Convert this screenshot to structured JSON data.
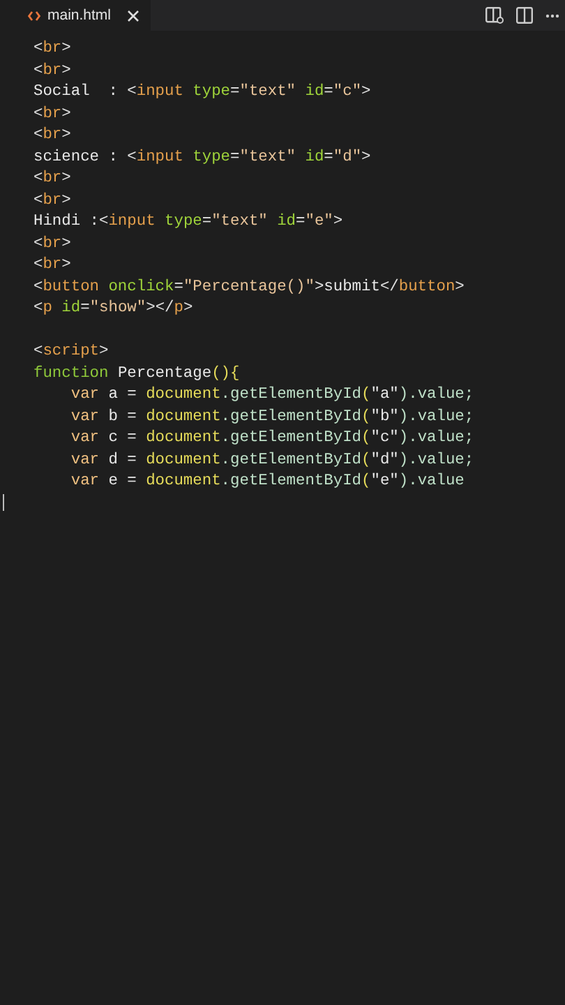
{
  "tabs": [
    {
      "label": "main.html",
      "selected": true
    }
  ],
  "lines": [
    {
      "kind": "code",
      "tokens": [
        {
          "text": "<",
          "kind": "punct"
        },
        {
          "text": "br",
          "kind": "tag"
        },
        {
          "text": ">",
          "kind": "punct"
        }
      ]
    },
    {
      "kind": "code",
      "tokens": [
        {
          "text": "<",
          "kind": "punct"
        },
        {
          "text": "br",
          "kind": "tag"
        },
        {
          "text": ">",
          "kind": "punct"
        }
      ]
    },
    {
      "kind": "code",
      "tokens": [
        {
          "text": "Social  : ",
          "kind": "plain"
        },
        {
          "text": "<",
          "kind": "punct"
        },
        {
          "text": "input ",
          "kind": "tag"
        },
        {
          "text": "type",
          "kind": "attr"
        },
        {
          "text": "=",
          "kind": "plain"
        },
        {
          "text": "\"text\" ",
          "kind": "str"
        },
        {
          "text": "id",
          "kind": "attr"
        },
        {
          "text": "=",
          "kind": "plain"
        },
        {
          "text": "\"c\"",
          "kind": "str"
        },
        {
          "text": ">",
          "kind": "punct"
        }
      ]
    },
    {
      "kind": "code",
      "tokens": [
        {
          "text": "<",
          "kind": "punct"
        },
        {
          "text": "br",
          "kind": "tag"
        },
        {
          "text": ">",
          "kind": "punct"
        }
      ]
    },
    {
      "kind": "code",
      "tokens": [
        {
          "text": "<",
          "kind": "punct"
        },
        {
          "text": "br",
          "kind": "tag"
        },
        {
          "text": ">",
          "kind": "punct"
        }
      ]
    },
    {
      "kind": "code",
      "tokens": [
        {
          "text": "science : ",
          "kind": "plain"
        },
        {
          "text": "<",
          "kind": "punct"
        },
        {
          "text": "input ",
          "kind": "tag"
        },
        {
          "text": "type",
          "kind": "attr"
        },
        {
          "text": "=",
          "kind": "plain"
        },
        {
          "text": "\"text\" ",
          "kind": "str"
        },
        {
          "text": "id",
          "kind": "attr"
        },
        {
          "text": "=",
          "kind": "plain"
        },
        {
          "text": "\"d\"",
          "kind": "str"
        },
        {
          "text": ">",
          "kind": "punct"
        }
      ]
    },
    {
      "kind": "code",
      "tokens": [
        {
          "text": "<",
          "kind": "punct"
        },
        {
          "text": "br",
          "kind": "tag"
        },
        {
          "text": ">",
          "kind": "punct"
        }
      ]
    },
    {
      "kind": "code",
      "tokens": [
        {
          "text": "<",
          "kind": "punct"
        },
        {
          "text": "br",
          "kind": "tag"
        },
        {
          "text": ">",
          "kind": "punct"
        }
      ]
    },
    {
      "kind": "code",
      "tokens": [
        {
          "text": "Hindi :",
          "kind": "plain"
        },
        {
          "text": "<",
          "kind": "punct"
        },
        {
          "text": "input ",
          "kind": "tag"
        },
        {
          "text": "type",
          "kind": "attr"
        },
        {
          "text": "=",
          "kind": "plain"
        },
        {
          "text": "\"text\" ",
          "kind": "str"
        },
        {
          "text": "id",
          "kind": "attr"
        },
        {
          "text": "=",
          "kind": "plain"
        },
        {
          "text": "\"e\"",
          "kind": "str"
        },
        {
          "text": ">",
          "kind": "punct"
        }
      ]
    },
    {
      "kind": "code",
      "tokens": [
        {
          "text": "<",
          "kind": "punct"
        },
        {
          "text": "br",
          "kind": "tag"
        },
        {
          "text": ">",
          "kind": "punct"
        }
      ]
    },
    {
      "kind": "code",
      "tokens": [
        {
          "text": "<",
          "kind": "punct"
        },
        {
          "text": "br",
          "kind": "tag"
        },
        {
          "text": ">",
          "kind": "punct"
        }
      ]
    },
    {
      "kind": "code",
      "tokens": [
        {
          "text": "<",
          "kind": "punct"
        },
        {
          "text": "button ",
          "kind": "tag"
        },
        {
          "text": "onclick",
          "kind": "attr"
        },
        {
          "text": "=",
          "kind": "plain"
        },
        {
          "text": "\"Percentage()\"",
          "kind": "str"
        },
        {
          "text": ">submit",
          "kind": "plain"
        },
        {
          "text": "</",
          "kind": "punct"
        },
        {
          "text": "button",
          "kind": "tag"
        },
        {
          "text": ">",
          "kind": "punct"
        }
      ]
    },
    {
      "kind": "code",
      "tokens": [
        {
          "text": "<",
          "kind": "punct"
        },
        {
          "text": "p ",
          "kind": "tag"
        },
        {
          "text": "id",
          "kind": "attr"
        },
        {
          "text": "=",
          "kind": "plain"
        },
        {
          "text": "\"show\"",
          "kind": "str"
        },
        {
          "text": "></",
          "kind": "punct"
        },
        {
          "text": "p",
          "kind": "tag"
        },
        {
          "text": ">",
          "kind": "punct"
        }
      ]
    },
    {
      "kind": "blank"
    },
    {
      "kind": "code",
      "tokens": [
        {
          "text": "<",
          "kind": "punct"
        },
        {
          "text": "script",
          "kind": "tag"
        },
        {
          "text": ">",
          "kind": "punct"
        }
      ]
    },
    {
      "kind": "code",
      "tokens": [
        {
          "text": "function ",
          "kind": "kw"
        },
        {
          "text": "Percentage",
          "kind": "plain"
        },
        {
          "text": "(){",
          "kind": "obj"
        }
      ]
    },
    {
      "kind": "code",
      "tokens": [
        {
          "text": "    var ",
          "kind": "var"
        },
        {
          "text": "a = ",
          "kind": "plain"
        },
        {
          "text": "document",
          "kind": "obj"
        },
        {
          "text": ".getElementById",
          "kind": "method"
        },
        {
          "text": "(",
          "kind": "obj"
        },
        {
          "text": "\"a\"",
          "kind": "plain"
        },
        {
          "text": ").value;",
          "kind": "method"
        }
      ]
    },
    {
      "kind": "code",
      "tokens": [
        {
          "text": "    var ",
          "kind": "var"
        },
        {
          "text": "b = ",
          "kind": "plain"
        },
        {
          "text": "document",
          "kind": "obj"
        },
        {
          "text": ".getElementById",
          "kind": "method"
        },
        {
          "text": "(",
          "kind": "obj"
        },
        {
          "text": "\"b\"",
          "kind": "plain"
        },
        {
          "text": ").value;",
          "kind": "method"
        }
      ]
    },
    {
      "kind": "code",
      "tokens": [
        {
          "text": "    var ",
          "kind": "var"
        },
        {
          "text": "c = ",
          "kind": "plain"
        },
        {
          "text": "document",
          "kind": "obj"
        },
        {
          "text": ".getElementById",
          "kind": "method"
        },
        {
          "text": "(",
          "kind": "obj"
        },
        {
          "text": "\"c\"",
          "kind": "plain"
        },
        {
          "text": ").value;",
          "kind": "method"
        }
      ]
    },
    {
      "kind": "code",
      "tokens": [
        {
          "text": "    var ",
          "kind": "var"
        },
        {
          "text": "d = ",
          "kind": "plain"
        },
        {
          "text": "document",
          "kind": "obj"
        },
        {
          "text": ".getElementById",
          "kind": "method"
        },
        {
          "text": "(",
          "kind": "obj"
        },
        {
          "text": "\"d\"",
          "kind": "plain"
        },
        {
          "text": ").value;",
          "kind": "method"
        }
      ]
    },
    {
      "kind": "code",
      "tokens": [
        {
          "text": "    var ",
          "kind": "var"
        },
        {
          "text": "e = ",
          "kind": "plain"
        },
        {
          "text": "document",
          "kind": "obj"
        },
        {
          "text": ".getElementById",
          "kind": "method"
        },
        {
          "text": "(",
          "kind": "obj"
        },
        {
          "text": "\"e\"",
          "kind": "plain"
        },
        {
          "text": ").value",
          "kind": "method"
        }
      ]
    },
    {
      "kind": "cursor"
    }
  ]
}
